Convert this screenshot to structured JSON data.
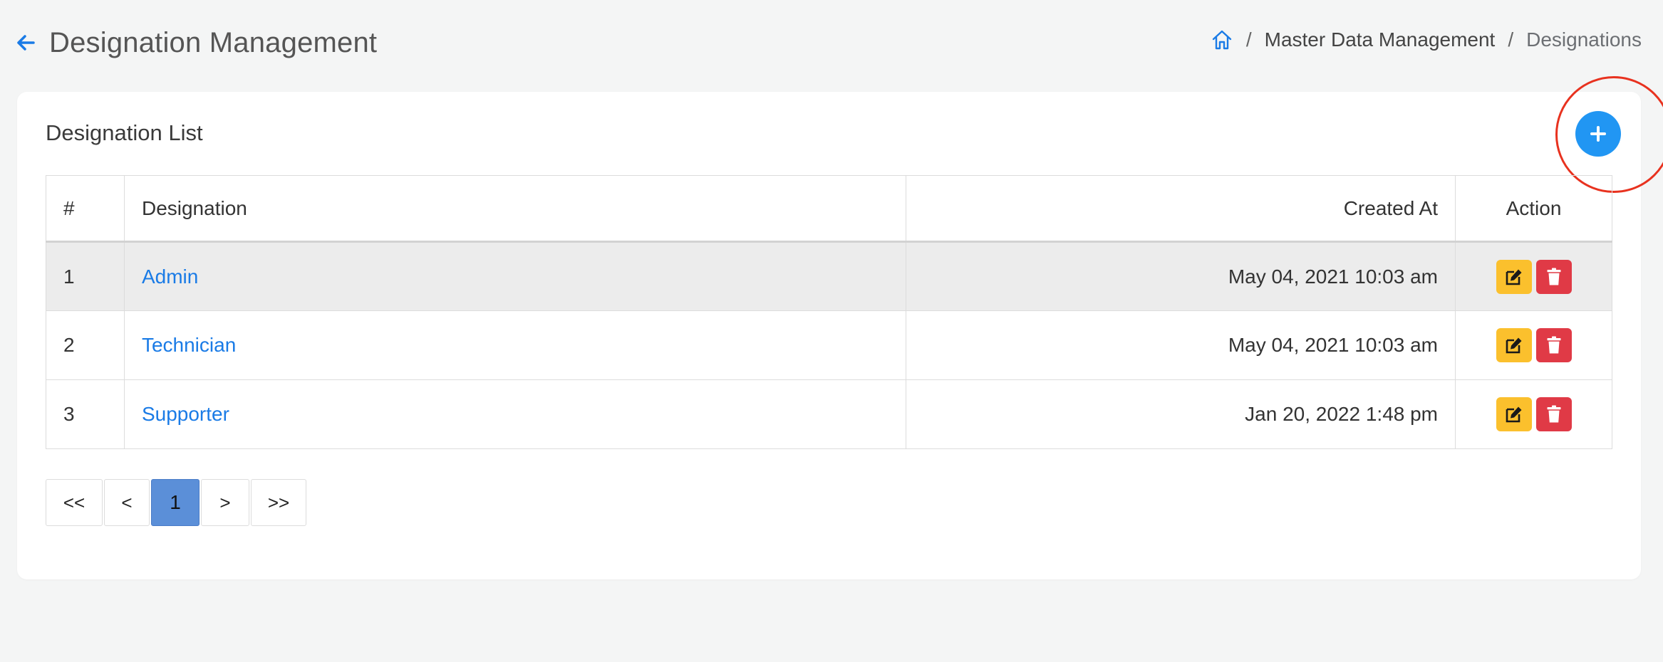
{
  "header": {
    "title": "Designation Management",
    "back_icon": "arrow-left-icon"
  },
  "breadcrumb": {
    "home_icon": "home-icon",
    "separator": "/",
    "items": [
      {
        "label": "Master Data Management"
      },
      {
        "label": "Designations"
      }
    ]
  },
  "card": {
    "title": "Designation List",
    "add_icon": "plus-icon"
  },
  "table": {
    "columns": [
      "#",
      "Designation",
      "Created At",
      "Action"
    ],
    "rows": [
      {
        "num": "1",
        "designation": "Admin",
        "created_at": "May 04, 2021 10:03 am"
      },
      {
        "num": "2",
        "designation": "Technician",
        "created_at": "May 04, 2021 10:03 am"
      },
      {
        "num": "3",
        "designation": "Supporter",
        "created_at": "Jan 20, 2022 1:48 pm"
      }
    ]
  },
  "pagination": {
    "first": "<<",
    "prev": "<",
    "current": "1",
    "next": ">",
    "last": ">>"
  },
  "colors": {
    "accent": "#2196f3",
    "link": "#1a7be6",
    "edit": "#fbc02d",
    "delete": "#e03a46",
    "annotation": "#e8321f"
  }
}
